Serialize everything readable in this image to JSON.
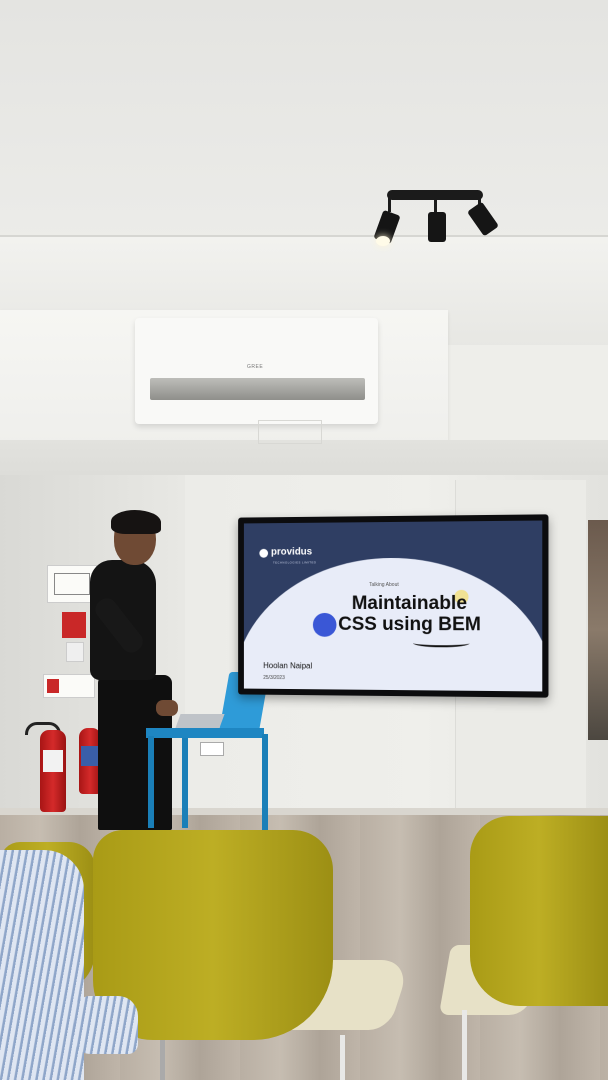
{
  "slide": {
    "brand": "providus",
    "brand_subtitle": "TECHNOLOGIES LIMITED",
    "talk_label": "Talking About",
    "title_line1": "Maintainable",
    "title_line2": "CSS using BEM",
    "speaker": "Hoolan Naipal",
    "date": "25/3/2023"
  },
  "ac_unit": {
    "brand": "GREE"
  },
  "colors": {
    "screen_background": "#2f3e63",
    "slide_dome": "#e8ecf8",
    "accent_blue": "#3a57d6",
    "accent_yellow": "#f2e07a",
    "podium": "#2e9bd8",
    "chair": "#bdae24"
  }
}
